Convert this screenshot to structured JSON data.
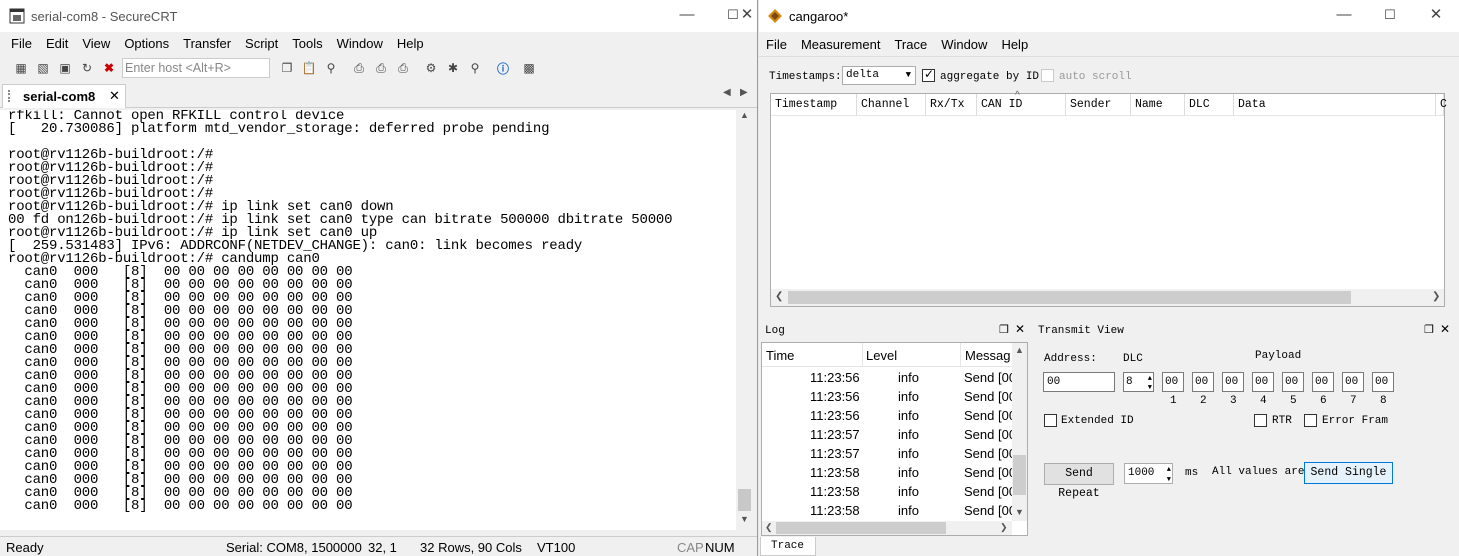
{
  "crt": {
    "title": "serial-com8 - SecureCRT",
    "menu": [
      "File",
      "Edit",
      "View",
      "Options",
      "Transfer",
      "Script",
      "Tools",
      "Window",
      "Help"
    ],
    "host_placeholder": "Enter host <Alt+R>",
    "tab": "serial-com8",
    "terminal_lines": [
      "rfkill: Cannot open RFKILL control device",
      "[   20.730086] platform mtd_vendor_storage: deferred probe pending",
      "",
      "root@rv1126b-buildroot:/#",
      "root@rv1126b-buildroot:/#",
      "root@rv1126b-buildroot:/#",
      "root@rv1126b-buildroot:/#",
      "root@rv1126b-buildroot:/# ip link set can0 down",
      "00 fd on126b-buildroot:/# ip link set can0 type can bitrate 500000 dbitrate 50000",
      "root@rv1126b-buildroot:/# ip link set can0 up",
      "[  259.531483] IPv6: ADDRCONF(NETDEV_CHANGE): can0: link becomes ready",
      "root@rv1126b-buildroot:/# candump can0",
      "  can0  000   [8]  00 00 00 00 00 00 00 00",
      "  can0  000   [8]  00 00 00 00 00 00 00 00",
      "  can0  000   [8]  00 00 00 00 00 00 00 00",
      "  can0  000   [8]  00 00 00 00 00 00 00 00",
      "  can0  000   [8]  00 00 00 00 00 00 00 00",
      "  can0  000   [8]  00 00 00 00 00 00 00 00",
      "  can0  000   [8]  00 00 00 00 00 00 00 00",
      "  can0  000   [8]  00 00 00 00 00 00 00 00",
      "  can0  000   [8]  00 00 00 00 00 00 00 00",
      "  can0  000   [8]  00 00 00 00 00 00 00 00",
      "  can0  000   [8]  00 00 00 00 00 00 00 00",
      "  can0  000   [8]  00 00 00 00 00 00 00 00",
      "  can0  000   [8]  00 00 00 00 00 00 00 00",
      "  can0  000   [8]  00 00 00 00 00 00 00 00",
      "  can0  000   [8]  00 00 00 00 00 00 00 00",
      "  can0  000   [8]  00 00 00 00 00 00 00 00",
      "  can0  000   [8]  00 00 00 00 00 00 00 00",
      "  can0  000   [8]  00 00 00 00 00 00 00 00",
      "  can0  000   [8]  00 00 00 00 00 00 00 00"
    ],
    "status": {
      "ready": "Ready",
      "port": "Serial: COM8, 1500000",
      "cursor": "32,   1",
      "size": "32 Rows, 90 Cols",
      "emu": "VT100",
      "cap": "CAP",
      "num": "NUM"
    }
  },
  "cg": {
    "title": "cangaroo*",
    "menu": [
      "File",
      "Measurement",
      "Trace",
      "Window",
      "Help"
    ],
    "timestamps_label": "Timestamps:",
    "timestamps_value": "delta",
    "aggregate_label": "aggregate by ID",
    "autoscroll_label": "auto scroll",
    "trace_columns": [
      "Timestamp",
      "Channel",
      "Rx/Tx",
      "CAN ID",
      "Sender",
      "Name",
      "DLC",
      "Data",
      "C"
    ],
    "log": {
      "title": "Log",
      "columns": [
        "Time",
        "Level",
        "Messag"
      ],
      "rows": [
        [
          "11:23:56",
          "info",
          "Send [00"
        ],
        [
          "11:23:56",
          "info",
          "Send [00"
        ],
        [
          "11:23:56",
          "info",
          "Send [00"
        ],
        [
          "11:23:57",
          "info",
          "Send [00"
        ],
        [
          "11:23:57",
          "info",
          "Send [00"
        ],
        [
          "11:23:58",
          "info",
          "Send [00"
        ],
        [
          "11:23:58",
          "info",
          "Send [00"
        ],
        [
          "11:23:58",
          "info",
          "Send [00"
        ]
      ]
    },
    "transmit": {
      "title": "Transmit View",
      "address_label": "Address:",
      "address_value": "00",
      "dlc_label": "DLC",
      "dlc_value": "8",
      "payload_label": "Payload",
      "payload": [
        "00",
        "00",
        "00",
        "00",
        "00",
        "00",
        "00",
        "00"
      ],
      "payload_idx": [
        "1",
        "2",
        "3",
        "4",
        "5",
        "6",
        "7",
        "8"
      ],
      "extended_label": "Extended ID",
      "rtr_label": "RTR",
      "error_label": "Error Frame",
      "send_repeat": "Send Repeat",
      "interval": "1000",
      "ms": "ms",
      "all_values": "All values are",
      "send_single": "Send Single"
    },
    "bottom_tab": "Trace"
  }
}
